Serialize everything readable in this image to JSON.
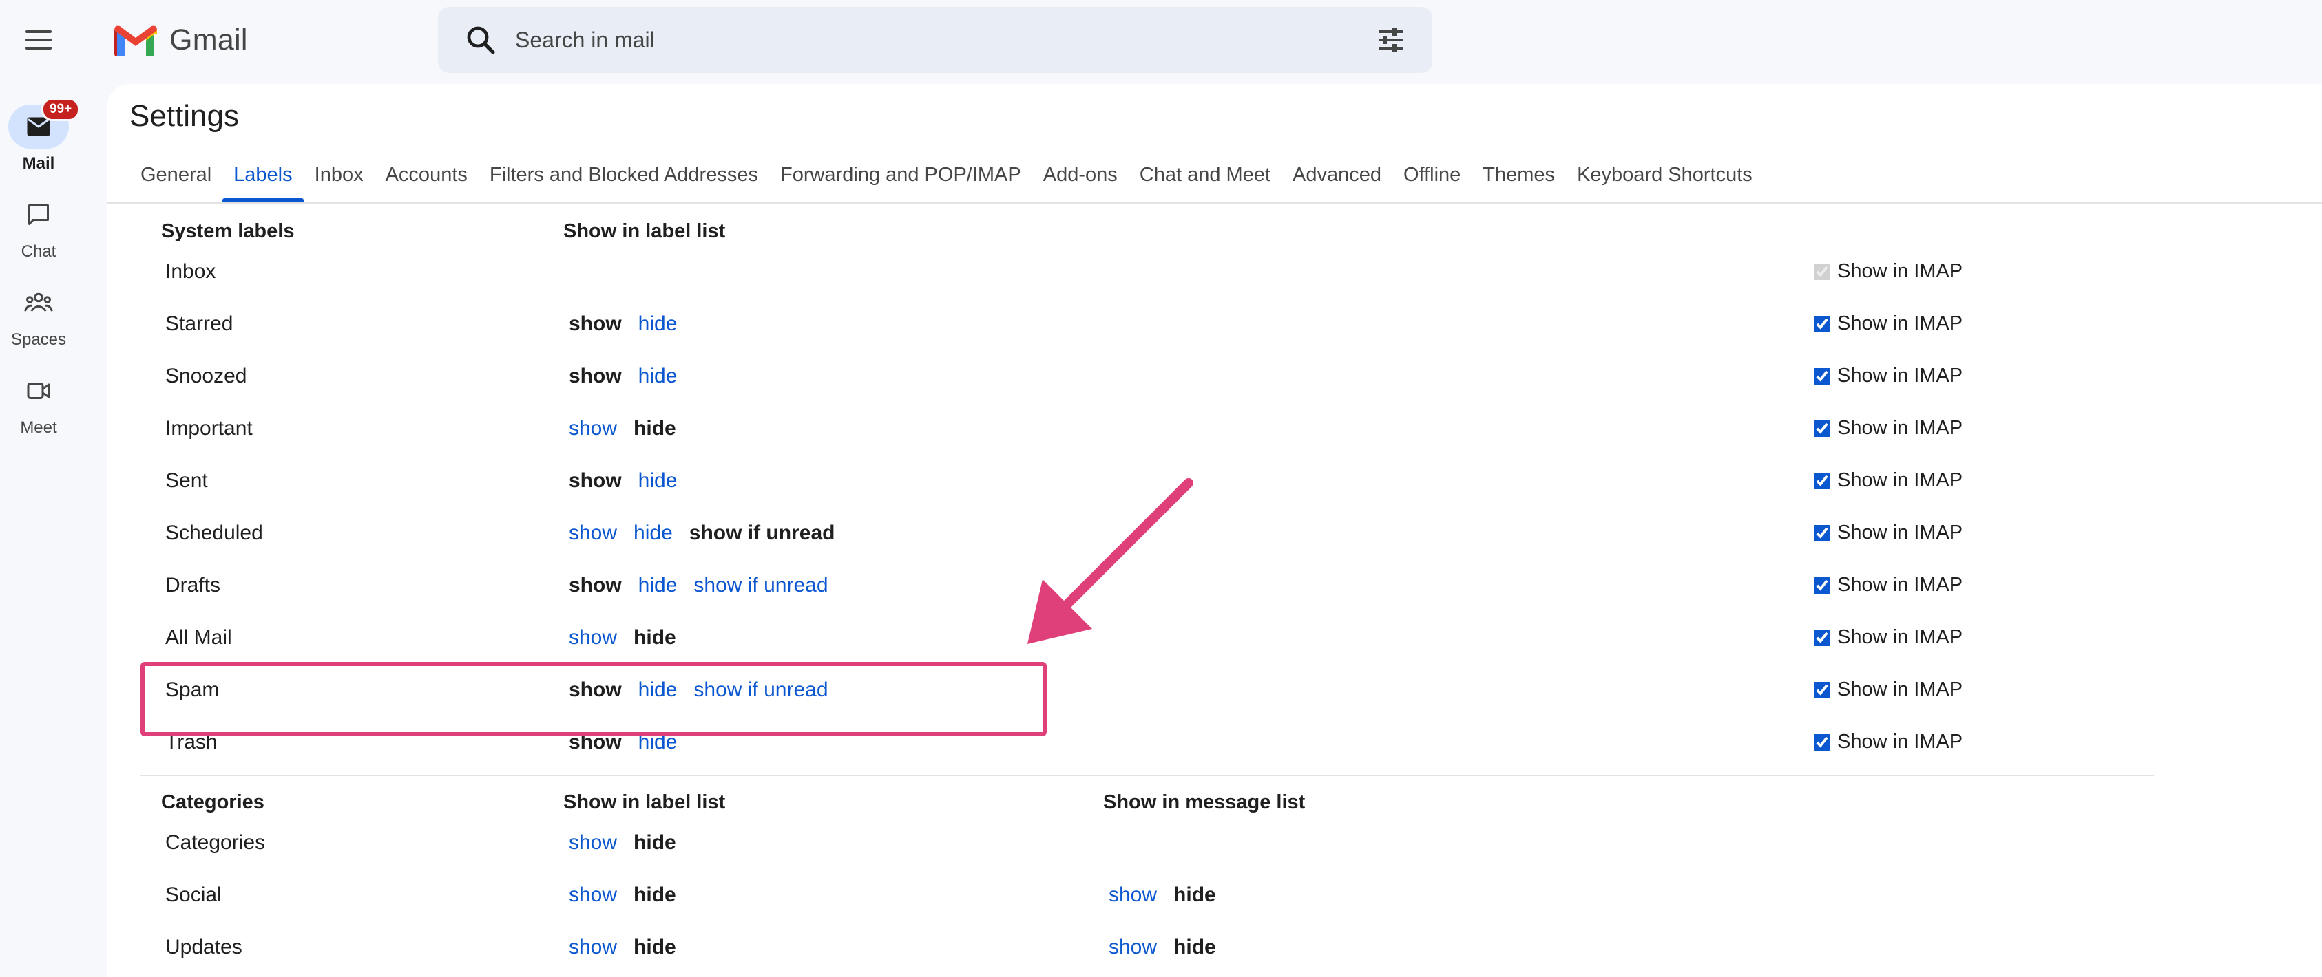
{
  "app": {
    "name": "Gmail"
  },
  "search": {
    "placeholder": "Search in mail"
  },
  "rail": [
    {
      "label": "Mail",
      "badge": "99+"
    },
    {
      "label": "Chat"
    },
    {
      "label": "Spaces"
    },
    {
      "label": "Meet"
    }
  ],
  "page": {
    "title": "Settings"
  },
  "tabs": [
    "General",
    "Labels",
    "Inbox",
    "Accounts",
    "Filters and Blocked Addresses",
    "Forwarding and POP/IMAP",
    "Add-ons",
    "Chat and Meet",
    "Advanced",
    "Offline",
    "Themes",
    "Keyboard Shortcuts"
  ],
  "active_tab": "Labels",
  "system": {
    "header": "System labels",
    "col_header": "Show in label list",
    "imap_label": "Show in IMAP",
    "rows": [
      {
        "name": "Inbox",
        "options": [],
        "imap_checked": true,
        "imap_disabled": true
      },
      {
        "name": "Starred",
        "options": [
          {
            "text": "show",
            "selected": true
          },
          {
            "text": "hide",
            "selected": false
          }
        ],
        "imap_checked": true
      },
      {
        "name": "Snoozed",
        "options": [
          {
            "text": "show",
            "selected": true
          },
          {
            "text": "hide",
            "selected": false
          }
        ],
        "imap_checked": true
      },
      {
        "name": "Important",
        "options": [
          {
            "text": "show",
            "selected": false
          },
          {
            "text": "hide",
            "selected": true
          }
        ],
        "imap_checked": true
      },
      {
        "name": "Sent",
        "options": [
          {
            "text": "show",
            "selected": true
          },
          {
            "text": "hide",
            "selected": false
          }
        ],
        "imap_checked": true
      },
      {
        "name": "Scheduled",
        "options": [
          {
            "text": "show",
            "selected": false
          },
          {
            "text": "hide",
            "selected": false
          },
          {
            "text": "show if unread",
            "selected": true
          }
        ],
        "imap_checked": true
      },
      {
        "name": "Drafts",
        "options": [
          {
            "text": "show",
            "selected": true
          },
          {
            "text": "hide",
            "selected": false
          },
          {
            "text": "show if unread",
            "selected": false
          }
        ],
        "imap_checked": true
      },
      {
        "name": "All Mail",
        "options": [
          {
            "text": "show",
            "selected": false
          },
          {
            "text": "hide",
            "selected": true
          }
        ],
        "imap_checked": true
      },
      {
        "name": "Spam",
        "options": [
          {
            "text": "show",
            "selected": true
          },
          {
            "text": "hide",
            "selected": false
          },
          {
            "text": "show if unread",
            "selected": false
          }
        ],
        "imap_checked": true
      },
      {
        "name": "Trash",
        "options": [
          {
            "text": "show",
            "selected": true
          },
          {
            "text": "hide",
            "selected": false
          }
        ],
        "imap_checked": true
      }
    ]
  },
  "categories": {
    "header": "Categories",
    "col_header": "Show in label list",
    "col2_header": "Show in message list",
    "rows": [
      {
        "name": "Categories",
        "options": [
          {
            "text": "show",
            "selected": false
          },
          {
            "text": "hide",
            "selected": true
          }
        ],
        "message_options": []
      },
      {
        "name": "Social",
        "options": [
          {
            "text": "show",
            "selected": false
          },
          {
            "text": "hide",
            "selected": true
          }
        ],
        "message_options": [
          {
            "text": "show",
            "selected": false
          },
          {
            "text": "hide",
            "selected": true
          }
        ]
      },
      {
        "name": "Updates",
        "options": [
          {
            "text": "show",
            "selected": false
          },
          {
            "text": "hide",
            "selected": true
          }
        ],
        "message_options": [
          {
            "text": "show",
            "selected": false
          },
          {
            "text": "hide",
            "selected": true
          }
        ]
      }
    ]
  },
  "colors": {
    "link": "#0b57d0",
    "annotation": "#e0407a",
    "active_rail": "#d3e3fd",
    "badge": "#c5221f"
  }
}
